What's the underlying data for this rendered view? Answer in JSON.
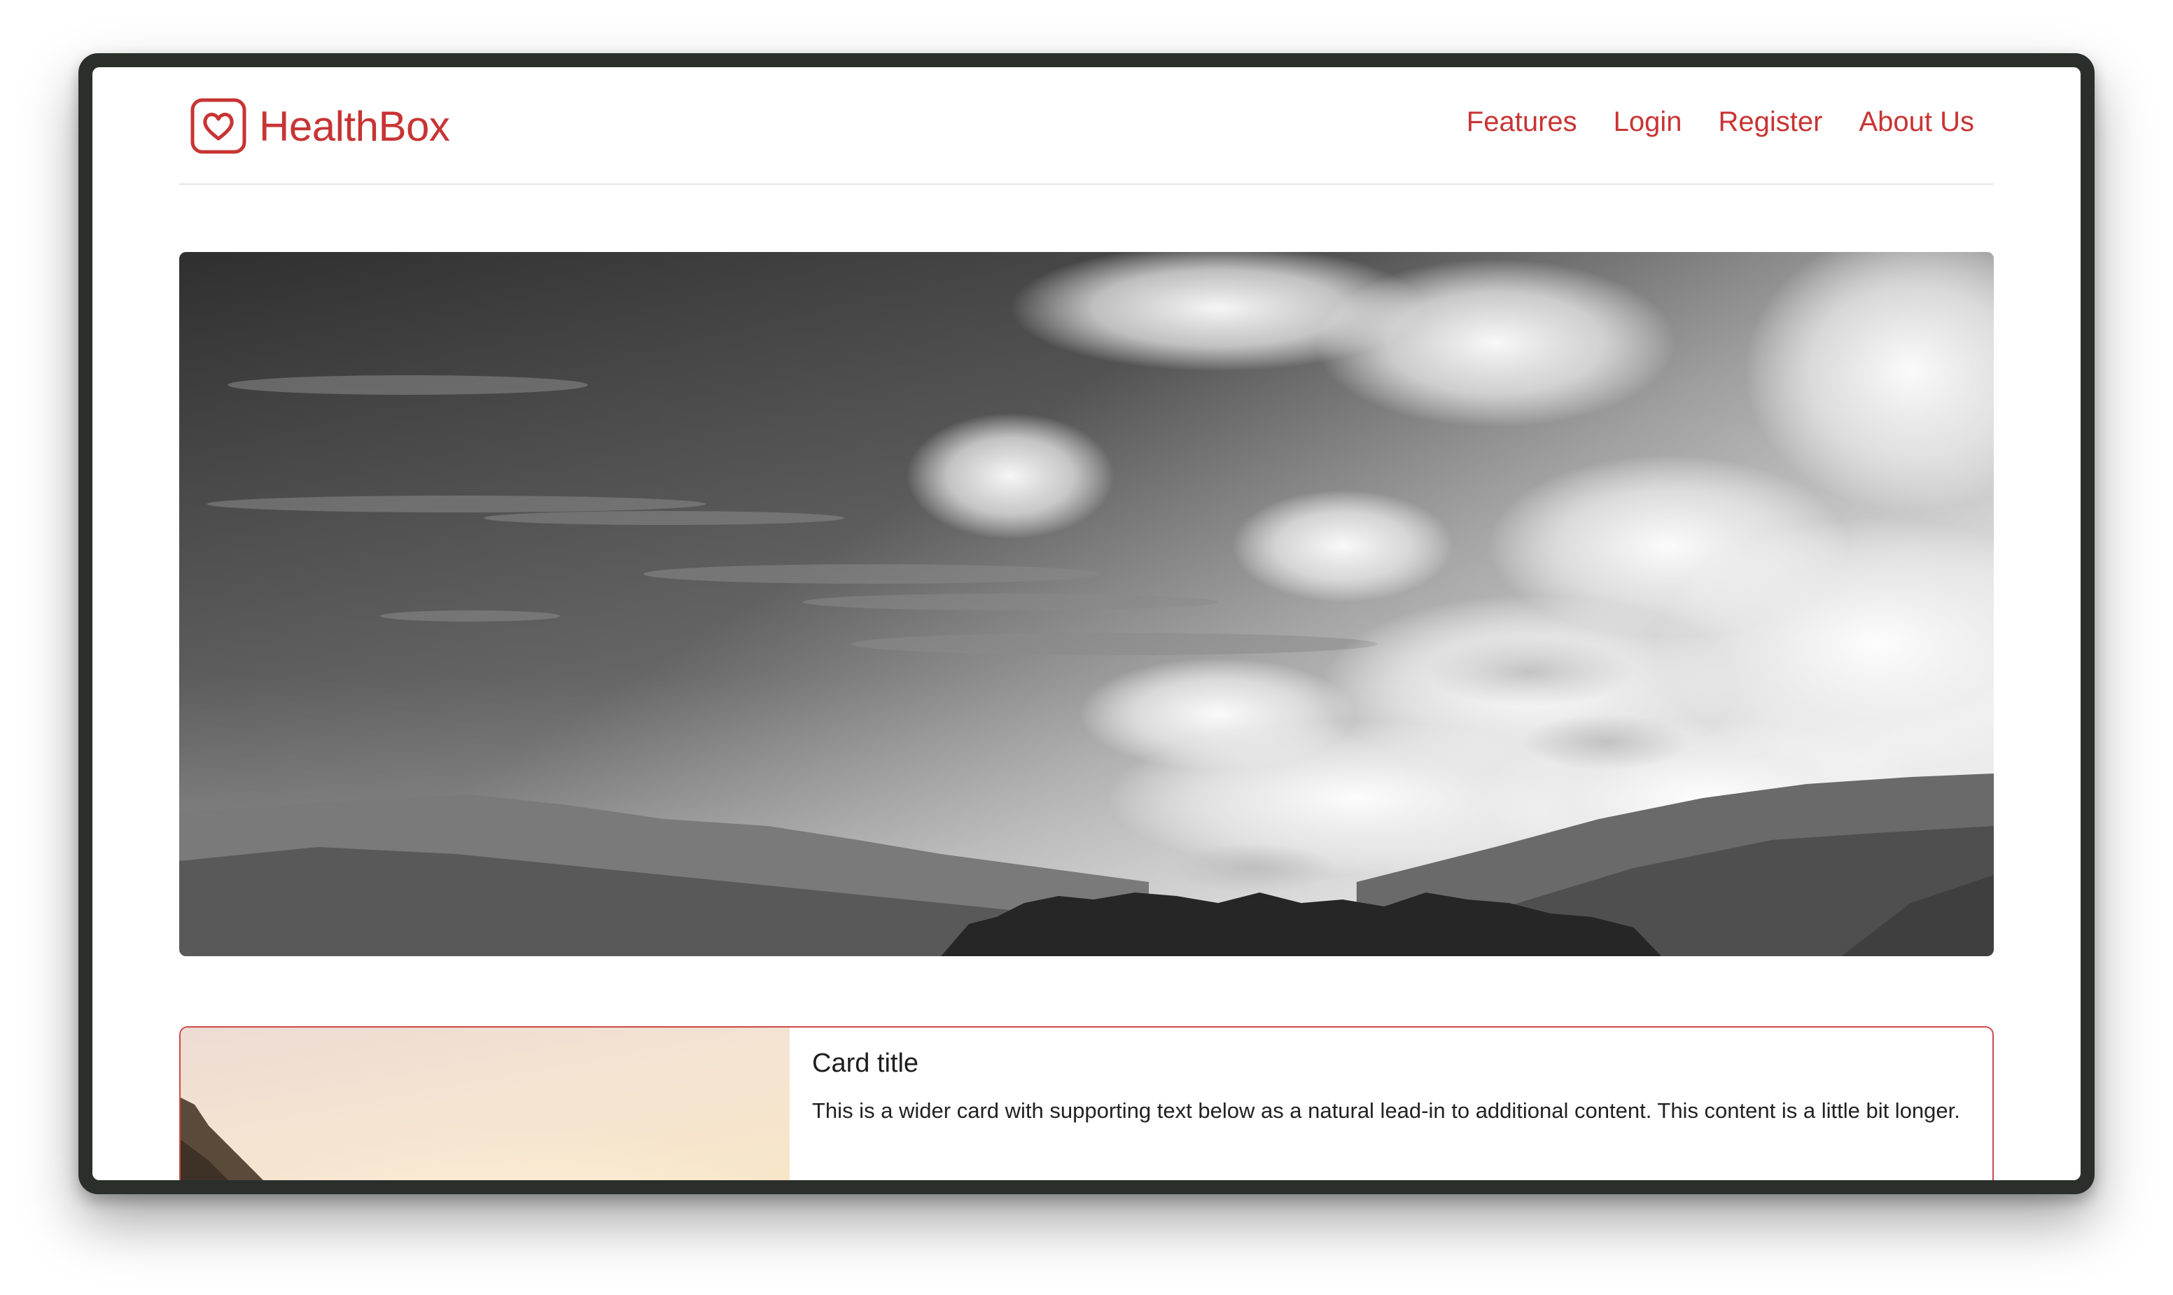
{
  "header": {
    "brand_name": "HealthBox",
    "brand_icon": "heart-icon",
    "brand_color": "#c83434",
    "nav": [
      {
        "label": "Features"
      },
      {
        "label": "Login"
      },
      {
        "label": "Register"
      },
      {
        "label": "About Us"
      }
    ]
  },
  "hero": {
    "image": "mountain-clouds-grayscale-photo"
  },
  "card": {
    "image": "sunset-hillside-photo",
    "title": "Card title",
    "text": "This is a wider card with supporting text below as a natural lead-in to additional content. This content is a little bit longer."
  }
}
